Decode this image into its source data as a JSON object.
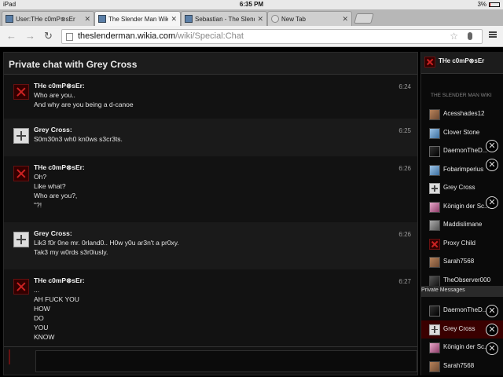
{
  "status_bar": {
    "device": "iPad",
    "time": "6:35 PM",
    "battery": "3%"
  },
  "tabs": [
    {
      "title": "User:THe c0mP⊗sEr"
    },
    {
      "title": "The Slender Man Wiki"
    },
    {
      "title": "Sebastian - The Slend"
    },
    {
      "title": "New Tab"
    }
  ],
  "omnibox": {
    "host": "theslenderman.wikia.com",
    "path": "/wiki/Special:Chat"
  },
  "chat": {
    "header": "Private chat with Grey Cross",
    "messages": [
      {
        "user": "THe c0mP⊗sEr:",
        "time": "6:24",
        "lines": [
          "Who are you..",
          "And why are you being a d-canoe"
        ]
      },
      {
        "user": "Grey Cross:",
        "time": "6:25",
        "lines": [
          "S0m30n3 wh0 kn0ws s3cr3ts."
        ]
      },
      {
        "user": "THe c0mP⊗sEr:",
        "time": "6:26",
        "lines": [
          "Oh?",
          "Like what?",
          "Who are you?,",
          "\"?!"
        ]
      },
      {
        "user": "Grey Cross:",
        "time": "6:26",
        "lines": [
          "Lik3 f0r 0ne mr. 0rland0.. H0w y0u ar3n't a pr0xy.",
          "Tak3 my w0rds s3r0iusly."
        ]
      },
      {
        "user": "THe c0mP⊗sEr:",
        "time": "6:27",
        "lines": [
          "...",
          "AH FUCK YOU",
          "HOW",
          "DO",
          "YOU",
          "KNOW"
        ]
      }
    ],
    "input_value": ""
  },
  "sidebar": {
    "me": "THe c0mP⊗sEr",
    "wiki_name": "THE SLENDER MAN WIKI",
    "users": [
      "Acesshades12",
      "Clover Stone",
      "DaemonTheD...",
      "Fobarimperius",
      "Grey Cross",
      "Königin der Sc...",
      "Maddislimane",
      "Proxy Child",
      "Sarah7568",
      "TheObserver000"
    ],
    "pm_header": "Private Messages",
    "private_messages": [
      "DaemonTheD...",
      "Grey Cross",
      "Königin der Sc...",
      "Sarah7568"
    ]
  }
}
